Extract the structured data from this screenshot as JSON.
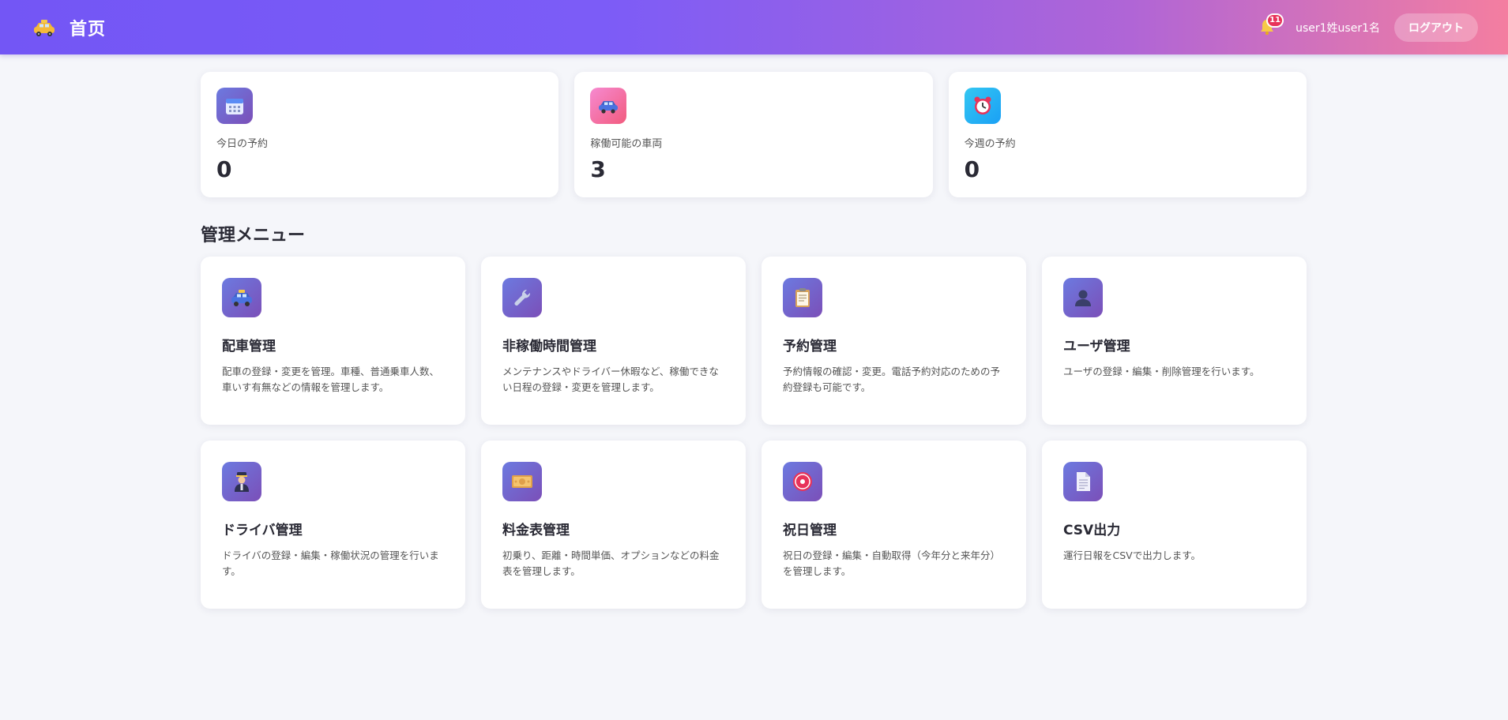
{
  "header": {
    "title": "首页",
    "notification_count": "11",
    "user_name": "user1姓user1名",
    "logout_label": "ログアウト"
  },
  "stats": [
    {
      "label": "今日の予約",
      "value": "0",
      "icon": "calendar-icon"
    },
    {
      "label": "稼働可能の車両",
      "value": "3",
      "icon": "car-icon"
    },
    {
      "label": "今週の予約",
      "value": "0",
      "icon": "alarm-clock-icon"
    }
  ],
  "menu": {
    "section_title": "管理メニュー",
    "items": [
      {
        "title": "配車管理",
        "desc": "配車の登録・変更を管理。車種、普通乗車人数、車いす有無などの情報を管理します。",
        "icon": "taxi-icon"
      },
      {
        "title": "非稼働時間管理",
        "desc": "メンテナンスやドライバー休暇など、稼働できない日程の登録・変更を管理します。",
        "icon": "wrench-icon"
      },
      {
        "title": "予約管理",
        "desc": "予約情報の確認・変更。電話予約対応のための予約登録も可能です。",
        "icon": "clipboard-icon"
      },
      {
        "title": "ユーザ管理",
        "desc": "ユーザの登録・編集・削除管理を行います。",
        "icon": "user-icon"
      },
      {
        "title": "ドライバ管理",
        "desc": "ドライバの登録・編集・稼働状況の管理を行います。",
        "icon": "driver-icon"
      },
      {
        "title": "料金表管理",
        "desc": "初乗り、距離・時間単価、オプションなどの料金表を管理します。",
        "icon": "yen-icon"
      },
      {
        "title": "祝日管理",
        "desc": "祝日の登録・編集・自動取得（今年分と来年分）を管理します。",
        "icon": "holiday-icon"
      },
      {
        "title": "CSV出力",
        "desc": "運行日報をCSVで出力します。",
        "icon": "document-icon"
      }
    ]
  },
  "colors": {
    "header_gradient_start": "#7356f5",
    "header_gradient_end": "#f47ea0",
    "background": "#f5f6fa",
    "badge": "#e8335a"
  }
}
